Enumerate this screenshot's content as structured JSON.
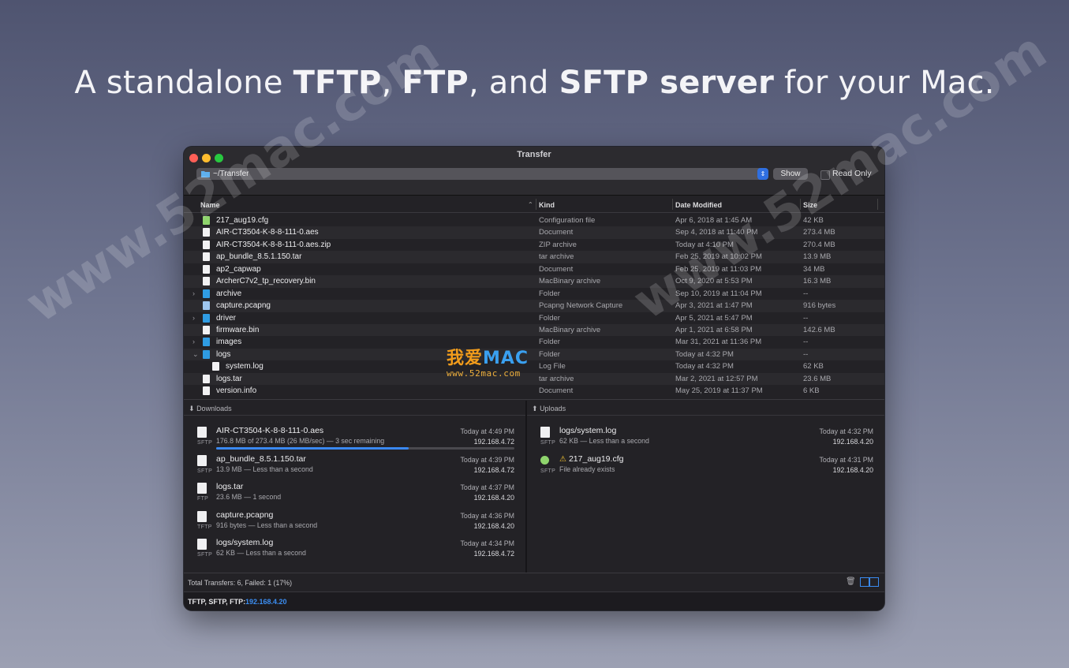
{
  "headline": {
    "part1": "A standalone ",
    "bold1": "TFTP",
    "sep1": ", ",
    "bold2": "FTP",
    "sep2": ", and ",
    "bold3": "SFTP server",
    "part2": " for your Mac."
  },
  "watermarks": {
    "left": "www.52mac.com",
    "right": "www.52mac.com",
    "brand_cn": "我爱",
    "brand_mac": "MAC",
    "brand_url": "www.52mac.com"
  },
  "window": {
    "title": "Transfer",
    "path": "~/Transfer",
    "show_label": "Show",
    "read_only_label": "Read Only",
    "read_only_checked": false
  },
  "file_columns": {
    "name": "Name",
    "kind": "Kind",
    "date": "Date Modified",
    "size": "Size"
  },
  "files": [
    {
      "name": "217_aug19.cfg",
      "kind": "Configuration file",
      "date": "Apr 6, 2018 at 1:45 AM",
      "size": "42 KB",
      "icon": "cfg-file-icon"
    },
    {
      "name": "AIR-CT3504-K-8-8-111-0.aes",
      "kind": "Document",
      "date": "Sep 4, 2018 at 11:40 PM",
      "size": "273.4 MB",
      "icon": "document-icon"
    },
    {
      "name": "AIR-CT3504-K-8-8-111-0.aes.zip",
      "kind": "ZIP archive",
      "date": "Today at 4:10 PM",
      "size": "270.4 MB",
      "icon": "zip-file-icon"
    },
    {
      "name": "ap_bundle_8.5.1.150.tar",
      "kind": "tar archive",
      "date": "Feb 25, 2019 at 10:02 PM",
      "size": "13.9 MB",
      "icon": "tar-file-icon"
    },
    {
      "name": "ap2_capwap",
      "kind": "Document",
      "date": "Feb 25, 2019 at 11:03 PM",
      "size": "34 MB",
      "icon": "document-icon"
    },
    {
      "name": "ArcherC7v2_tp_recovery.bin",
      "kind": "MacBinary archive",
      "date": "Oct 9, 2020 at 5:53 PM",
      "size": "16.3 MB",
      "icon": "binary-file-icon"
    },
    {
      "name": "archive",
      "kind": "Folder",
      "date": "Sep 10, 2019 at 11:04 PM",
      "size": "--",
      "icon": "folder-icon",
      "disclosure": "›"
    },
    {
      "name": "capture.pcapng",
      "kind": "Pcapng Network Capture",
      "date": "Apr 3, 2021 at 1:47 PM",
      "size": "916 bytes",
      "icon": "pcap-file-icon"
    },
    {
      "name": "driver",
      "kind": "Folder",
      "date": "Apr 5, 2021 at 5:47 PM",
      "size": "--",
      "icon": "folder-icon",
      "disclosure": "›"
    },
    {
      "name": "firmware.bin",
      "kind": "MacBinary archive",
      "date": "Apr 1, 2021 at 6:58 PM",
      "size": "142.6 MB",
      "icon": "binary-file-icon"
    },
    {
      "name": "images",
      "kind": "Folder",
      "date": "Mar 31, 2021 at 11:36 PM",
      "size": "--",
      "icon": "folder-icon",
      "disclosure": "›"
    },
    {
      "name": "logs",
      "kind": "Folder",
      "date": "Today at 4:32 PM",
      "size": "--",
      "icon": "folder-icon",
      "disclosure": "⌄"
    },
    {
      "name": "system.log",
      "kind": "Log File",
      "date": "Today at 4:32 PM",
      "size": "62 KB",
      "icon": "log-file-icon",
      "child": true
    },
    {
      "name": "logs.tar",
      "kind": "tar archive",
      "date": "Mar 2, 2021 at 12:57 PM",
      "size": "23.6 MB",
      "icon": "tar-file-icon"
    },
    {
      "name": "version.info",
      "kind": "Document",
      "date": "May 25, 2019 at 11:37 PM",
      "size": "6 KB",
      "icon": "document-icon"
    }
  ],
  "downloads": {
    "label": "Downloads",
    "items": [
      {
        "name": "AIR-CT3504-K-8-8-111-0.aes",
        "detail": "176.8 MB of 273.4 MB (26 MB/sec) — 3 sec remaining",
        "time": "Today at 4:49 PM",
        "ip": "192.168.4.72",
        "protocol": "SFTP",
        "progress": 0.646
      },
      {
        "name": "ap_bundle_8.5.1.150.tar",
        "detail": "13.9 MB — Less than a second",
        "time": "Today at 4:39 PM",
        "ip": "192.168.4.72",
        "protocol": "SFTP"
      },
      {
        "name": "logs.tar",
        "detail": "23.6 MB — 1 second",
        "time": "Today at 4:37 PM",
        "ip": "192.168.4.20",
        "protocol": "FTP"
      },
      {
        "name": "capture.pcapng",
        "detail": "916 bytes — Less than a second",
        "time": "Today at 4:36 PM",
        "ip": "192.168.4.20",
        "protocol": "TFTP"
      },
      {
        "name": "logs/system.log",
        "detail": "62 KB — Less than a second",
        "time": "Today at 4:34 PM",
        "ip": "192.168.4.72",
        "protocol": "SFTP"
      }
    ]
  },
  "uploads": {
    "label": "Uploads",
    "items": [
      {
        "name": "logs/system.log",
        "detail": "62 KB — Less than a second",
        "time": "Today at 4:32 PM",
        "ip": "192.168.4.20",
        "protocol": "SFTP"
      },
      {
        "name": "217_aug19.cfg",
        "detail": "File already exists",
        "time": "Today at 4:31 PM",
        "ip": "192.168.4.20",
        "protocol": "SFTP",
        "warning": true
      }
    ]
  },
  "totals": "Total Transfers: 6, Failed: 1 (17%)",
  "status": {
    "label": "TFTP, SFTP, FTP:",
    "ip": "192.168.4.20"
  }
}
